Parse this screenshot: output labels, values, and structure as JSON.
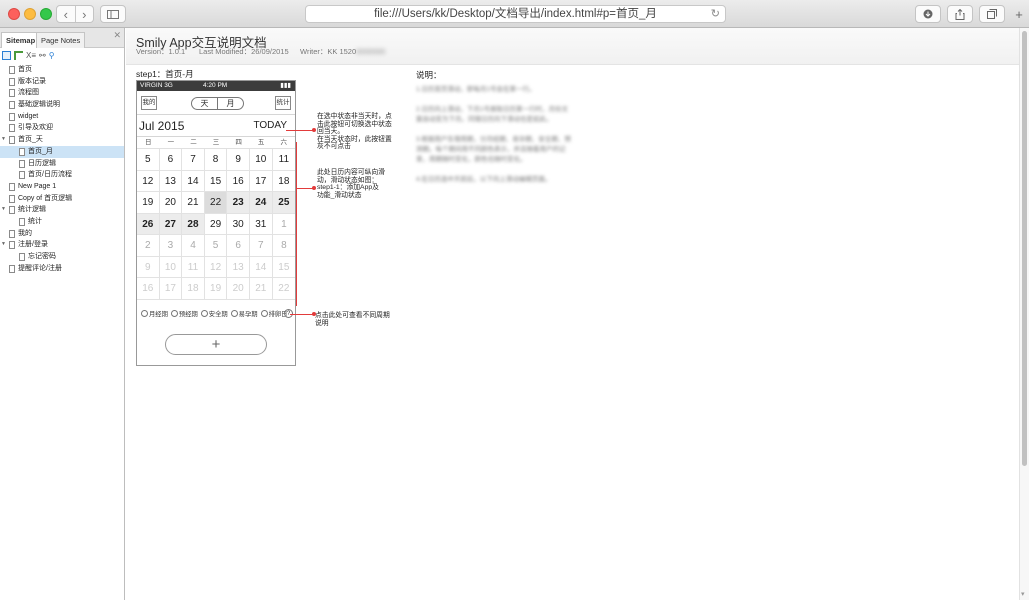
{
  "browser": {
    "url": "file:///Users/kk/Desktop/文档导出/index.html#p=首页_月",
    "back_icon": "chevron-left",
    "forward_icon": "chevron-right"
  },
  "sidebar": {
    "tabs": [
      "Sitemap",
      "Page Notes"
    ],
    "close": "✕",
    "toolbar_text": "X≡",
    "tree": [
      {
        "label": "首页",
        "depth": 0,
        "toggle": ""
      },
      {
        "label": "版本记录",
        "depth": 0,
        "toggle": ""
      },
      {
        "label": "流程图",
        "depth": 0,
        "toggle": ""
      },
      {
        "label": "基础逻辑说明",
        "depth": 0,
        "toggle": ""
      },
      {
        "label": "widget",
        "depth": 0,
        "toggle": ""
      },
      {
        "label": "引导及欢迎",
        "depth": 0,
        "toggle": ""
      },
      {
        "label": "首页_天",
        "depth": 0,
        "toggle": "▼"
      },
      {
        "label": "首页_月",
        "depth": 1,
        "toggle": "",
        "selected": true
      },
      {
        "label": "日历逻辑",
        "depth": 1,
        "toggle": ""
      },
      {
        "label": "首页/日历流程",
        "depth": 1,
        "toggle": ""
      },
      {
        "label": "New Page 1",
        "depth": 0,
        "toggle": ""
      },
      {
        "label": "Copy of 首页逻辑",
        "depth": 0,
        "toggle": ""
      },
      {
        "label": "统计逻辑",
        "depth": 0,
        "toggle": "▼"
      },
      {
        "label": "统计",
        "depth": 1,
        "toggle": ""
      },
      {
        "label": "我的",
        "depth": 0,
        "toggle": ""
      },
      {
        "label": "注册/登录",
        "depth": 0,
        "toggle": "▼"
      },
      {
        "label": "忘记密码",
        "depth": 1,
        "toggle": ""
      },
      {
        "label": "提醒评论/注册",
        "depth": 0,
        "toggle": ""
      }
    ]
  },
  "doc": {
    "title": "Smily App交互说明文档",
    "version": "Version：1.0.1",
    "modified": "Last Modified：26/09/2015",
    "writer": "Writer：KK 1520",
    "writer_hidden": "0000000",
    "step": "step1：首页-月"
  },
  "phone": {
    "carrier": "VIRGIN  3G",
    "time": "4:20 PM",
    "battery": "▮▮▮",
    "btn_left": "我的",
    "btn_right": "统计",
    "seg_day": "天",
    "seg_month": "月",
    "month": "Jul  2015",
    "today": "TODAY",
    "weekdays": [
      "日",
      "一",
      "二",
      "三",
      "四",
      "五",
      "六"
    ],
    "legend": [
      "月经期",
      "预经期",
      "安全期",
      "易孕期",
      "排卵日"
    ],
    "help": "?",
    "add": "+",
    "days": [
      {
        "d": "5",
        "s": "normal"
      },
      {
        "d": "6",
        "s": "normal"
      },
      {
        "d": "7",
        "s": "normal"
      },
      {
        "d": "8",
        "s": "normal"
      },
      {
        "d": "9",
        "s": "normal"
      },
      {
        "d": "10",
        "s": "normal"
      },
      {
        "d": "11",
        "s": "normal"
      },
      {
        "d": "12",
        "s": "normal"
      },
      {
        "d": "13",
        "s": "normal"
      },
      {
        "d": "14",
        "s": "normal"
      },
      {
        "d": "15",
        "s": "normal"
      },
      {
        "d": "16",
        "s": "normal"
      },
      {
        "d": "17",
        "s": "normal"
      },
      {
        "d": "18",
        "s": "normal"
      },
      {
        "d": "19",
        "s": "normal"
      },
      {
        "d": "20",
        "s": "normal"
      },
      {
        "d": "21",
        "s": "normal"
      },
      {
        "d": "22",
        "s": "today"
      },
      {
        "d": "23",
        "s": "sel"
      },
      {
        "d": "24",
        "s": "sel"
      },
      {
        "d": "25",
        "s": "sel"
      },
      {
        "d": "26",
        "s": "sel"
      },
      {
        "d": "27",
        "s": "sel"
      },
      {
        "d": "28",
        "s": "sel"
      },
      {
        "d": "29",
        "s": "normal"
      },
      {
        "d": "30",
        "s": "normal"
      },
      {
        "d": "31",
        "s": "normal"
      },
      {
        "d": "1",
        "s": "dim"
      },
      {
        "d": "2",
        "s": "dim"
      },
      {
        "d": "3",
        "s": "dim"
      },
      {
        "d": "4",
        "s": "dim"
      },
      {
        "d": "5",
        "s": "dim"
      },
      {
        "d": "6",
        "s": "dim"
      },
      {
        "d": "7",
        "s": "dim"
      },
      {
        "d": "8",
        "s": "dim"
      },
      {
        "d": "9",
        "s": "faint"
      },
      {
        "d": "10",
        "s": "faint"
      },
      {
        "d": "11",
        "s": "faint"
      },
      {
        "d": "12",
        "s": "faint"
      },
      {
        "d": "13",
        "s": "faint"
      },
      {
        "d": "14",
        "s": "faint"
      },
      {
        "d": "15",
        "s": "faint"
      },
      {
        "d": "16",
        "s": "faint"
      },
      {
        "d": "17",
        "s": "faint"
      },
      {
        "d": "18",
        "s": "faint"
      },
      {
        "d": "19",
        "s": "faint"
      },
      {
        "d": "20",
        "s": "faint"
      },
      {
        "d": "21",
        "s": "faint"
      },
      {
        "d": "22",
        "s": "faint"
      }
    ]
  },
  "annotations": {
    "today": "在选中状态非当天时，点\n击此按钮可切换选中状态\n回当天。\n在当天状态时，此按钮置\n灰不可点击",
    "scroll": "此处日历内容可纵向滑\n动，滑动状态如图：\nstep1-1：添加App及\n功能_滑动状态",
    "legend": "点击此处可查看不同周期\n说明"
  },
  "notes": {
    "title": "说明：",
    "lines": [
      "1.日历首页滑动，即每月1号会在第一行。",
      "",
      "2.日历向上滑动，下月1号展取日历第一行时，月份文",
      "案自动变为下月。同理日历向下滑动也是如此。",
      "",
      "3.根据用户生理周期，分月经期、易孕期、安全期、预",
      "测期。每个期间用不同颜色表示，并且随着用户的记",
      "录，周期随时变化，颜色也随时变化。",
      "",
      "4.在日历选中天前后，以下向上滑动编辑页面。"
    ]
  }
}
